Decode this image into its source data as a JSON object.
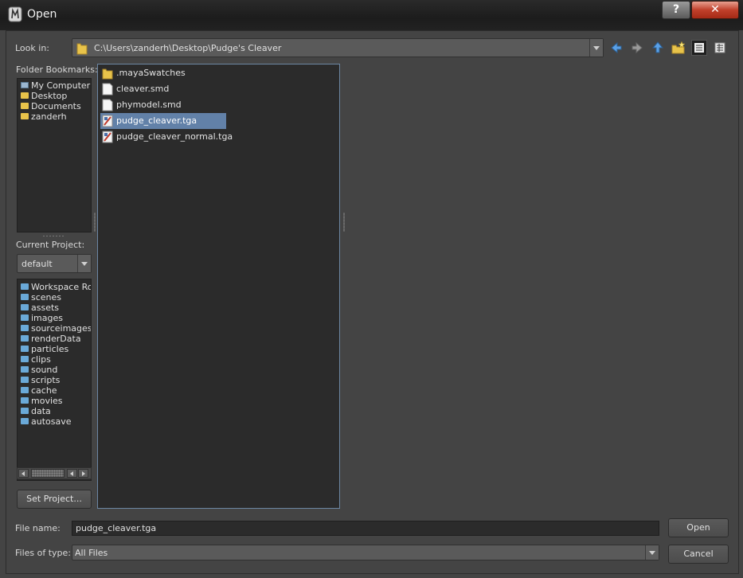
{
  "window": {
    "title": "Open",
    "help_label": "?",
    "close_label": "✕"
  },
  "look_in": {
    "label": "Look in:",
    "path": "C:\\Users\\zanderh\\Desktop\\Pudge's Cleaver"
  },
  "bookmarks": {
    "label": "Folder Bookmarks:",
    "items": [
      "My Computer",
      "Desktop",
      "Documents",
      "zanderh"
    ]
  },
  "project": {
    "label": "Current Project:",
    "selected": "default",
    "folders": [
      "Workspace Roo",
      "scenes",
      "assets",
      "images",
      "sourceimages",
      "renderData",
      "particles",
      "clips",
      "sound",
      "scripts",
      "cache",
      "movies",
      "data",
      "autosave"
    ],
    "set_project_label": "Set Project..."
  },
  "files": [
    {
      "name": ".mayaSwatches",
      "type": "folder"
    },
    {
      "name": "cleaver.smd",
      "type": "file"
    },
    {
      "name": "phymodel.smd",
      "type": "file"
    },
    {
      "name": "pudge_cleaver.tga",
      "type": "image",
      "selected": true
    },
    {
      "name": "pudge_cleaver_normal.tga",
      "type": "image"
    }
  ],
  "footer": {
    "file_name_label": "File name:",
    "file_name_value": "pudge_cleaver.tga",
    "files_of_type_label": "Files of type:",
    "files_of_type_value": "All Files",
    "open_label": "Open",
    "cancel_label": "Cancel"
  }
}
